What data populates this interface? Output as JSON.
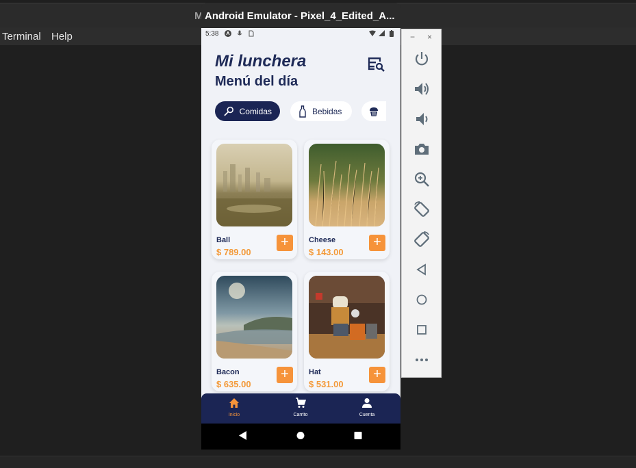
{
  "host": {
    "title_fragment": "M",
    "menu": [
      "Terminal",
      "Help"
    ]
  },
  "emulator": {
    "title": "Android Emulator - Pixel_4_Edited_A...",
    "side_panel": {
      "minimize": "−",
      "close": "×",
      "buttons": [
        "power-icon",
        "volume-up-icon",
        "volume-down-icon",
        "camera-icon",
        "zoom-icon",
        "rotate-left-icon",
        "rotate-right-icon",
        "back-icon",
        "home-icon",
        "overview-icon",
        "more-icon"
      ]
    }
  },
  "status_bar": {
    "time": "5:38"
  },
  "app": {
    "title": "Mi lunchera",
    "subtitle": "Menú del día",
    "categories": [
      {
        "label": "Comidas",
        "active": true,
        "icon": "utensil-icon"
      },
      {
        "label": "Bebidas",
        "active": false,
        "icon": "bottle-icon"
      },
      {
        "label": "",
        "active": false,
        "icon": "cupcake-icon"
      }
    ],
    "products": [
      {
        "name": "Ball",
        "price": "$ 789.00"
      },
      {
        "name": "Cheese",
        "price": "$ 143.00"
      },
      {
        "name": "Bacon",
        "price": "$ 635.00"
      },
      {
        "name": "Hat",
        "price": "$ 531.00"
      }
    ],
    "add_label": "+",
    "bottom_nav": [
      {
        "label": "Inicio",
        "icon": "home-icon",
        "active": true
      },
      {
        "label": "Carrito",
        "icon": "cart-icon",
        "active": false
      },
      {
        "label": "Cuenta",
        "icon": "person-icon",
        "active": false
      }
    ],
    "accent_color": "#f6933a",
    "primary_color": "#1b2554"
  }
}
